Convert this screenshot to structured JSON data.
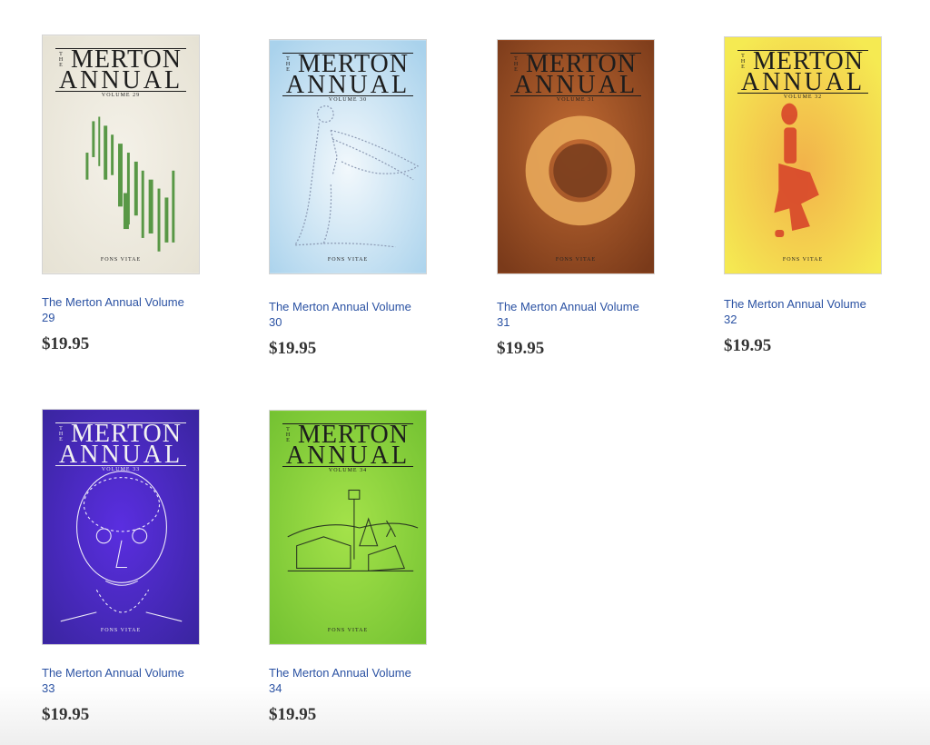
{
  "products": [
    {
      "title": "The Merton Annual Volume 29",
      "price": "$19.95",
      "cover": {
        "the": "THE",
        "line1": "MERTON",
        "line2": "ANNUAL",
        "volume": "VOLUME 29",
        "publisher": "FONS VITAE",
        "bg": "#efece2",
        "art_color": "#3f8a2c"
      }
    },
    {
      "title": "The Merton Annual Volume 30",
      "price": "$19.95",
      "cover": {
        "the": "THE",
        "line1": "MERTON",
        "line2": "ANNUAL",
        "volume": "VOLUME 30",
        "publisher": "FONS VITAE",
        "bg": "#cfe6f4",
        "art_color": "#8a98b2"
      }
    },
    {
      "title": "The Merton Annual Volume 31",
      "price": "$19.95",
      "cover": {
        "the": "THE",
        "line1": "MERTON",
        "line2": "ANNUAL",
        "volume": "VOLUME 31",
        "publisher": "FONS VITAE",
        "bg": "#a9562a",
        "art_color": "#e8a85a"
      }
    },
    {
      "title": "The Merton Annual Volume 32",
      "price": "$19.95",
      "cover": {
        "the": "THE",
        "line1": "MERTON",
        "line2": "ANNUAL",
        "volume": "VOLUME 32",
        "publisher": "FONS VITAE",
        "bg": "#f3e24a",
        "art_color": "#d8462a"
      }
    },
    {
      "title": "The Merton Annual Volume 33",
      "price": "$19.95",
      "cover": {
        "the": "THE",
        "line1": "MERTON",
        "line2": "ANNUAL",
        "volume": "VOLUME 33",
        "publisher": "FONS VITAE",
        "bg": "#4a2dc0",
        "art_color": "#ffffff"
      }
    },
    {
      "title": "The Merton Annual Volume 34",
      "price": "$19.95",
      "cover": {
        "the": "THE",
        "line1": "MERTON",
        "line2": "ANNUAL",
        "volume": "VOLUME 34",
        "publisher": "FONS VITAE",
        "bg": "#8fd63e",
        "art_color": "#2c3a22"
      }
    }
  ]
}
